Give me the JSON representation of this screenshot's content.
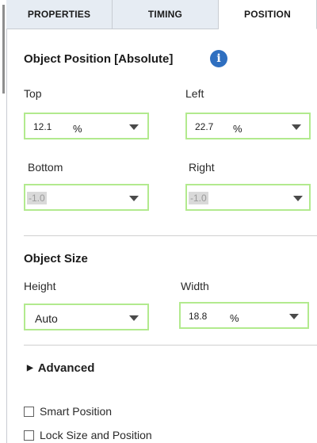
{
  "tabs": [
    "PROPERTIES",
    "TIMING",
    "POSITION"
  ],
  "position_section": {
    "title": "Object Position [Absolute]",
    "info_icon": "i",
    "top": {
      "label": "Top",
      "value": "12.1",
      "unit": "%"
    },
    "left": {
      "label": "Left",
      "value": "22.7",
      "unit": "%"
    },
    "bottom": {
      "label": "Bottom",
      "value": "-1.0"
    },
    "right": {
      "label": "Right",
      "value": "-1.0"
    }
  },
  "size_section": {
    "title": "Object Size",
    "height": {
      "label": "Height",
      "value": "Auto"
    },
    "width": {
      "label": "Width",
      "value": "18.8",
      "unit": "%"
    }
  },
  "advanced_label": "Advanced",
  "checkboxes": [
    {
      "label": "Smart Position",
      "checked": false
    },
    {
      "label": "Lock Size and Position",
      "checked": false
    }
  ],
  "colors": {
    "field_border": "#b2ea8e",
    "tab_bg": "#e6ecf3",
    "info_icon": "#2f6fc0"
  }
}
